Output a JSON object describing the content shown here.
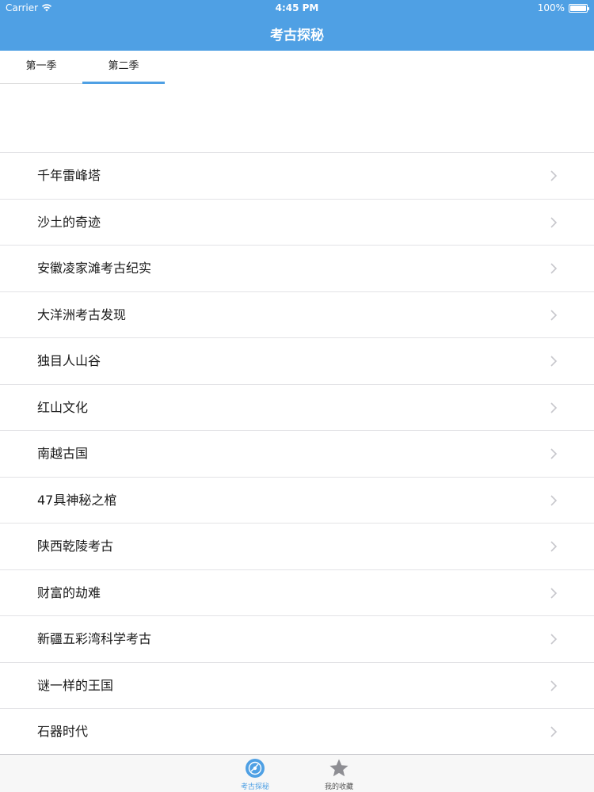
{
  "status_bar": {
    "carrier": "Carrier",
    "time": "4:45 PM",
    "battery": "100%",
    "battery_level": 1.0
  },
  "nav": {
    "title": "考古探秘"
  },
  "segments": [
    {
      "label": "第一季",
      "selected": false
    },
    {
      "label": "第二季",
      "selected": true
    }
  ],
  "list": {
    "items": [
      {
        "label": "千年雷峰塔"
      },
      {
        "label": "沙土的奇迹"
      },
      {
        "label": "安徽凌家滩考古纪实"
      },
      {
        "label": "大洋洲考古发现"
      },
      {
        "label": "独目人山谷"
      },
      {
        "label": "红山文化"
      },
      {
        "label": "南越古国"
      },
      {
        "label": "47具神秘之棺"
      },
      {
        "label": "陕西乾陵考古"
      },
      {
        "label": "财富的劫难"
      },
      {
        "label": "新疆五彩湾科学考古"
      },
      {
        "label": "谜一样的王国"
      },
      {
        "label": "石器时代"
      }
    ]
  },
  "tabbar": {
    "items": [
      {
        "label": "考古探秘",
        "icon": "disc-icon",
        "active": true
      },
      {
        "label": "我的收藏",
        "icon": "star-icon",
        "active": false
      }
    ]
  },
  "colors": {
    "accent": "#4fa0e4",
    "header_text": "#ffffff",
    "row_text": "#1a1a1a",
    "chevron": "#c7c7cc"
  }
}
